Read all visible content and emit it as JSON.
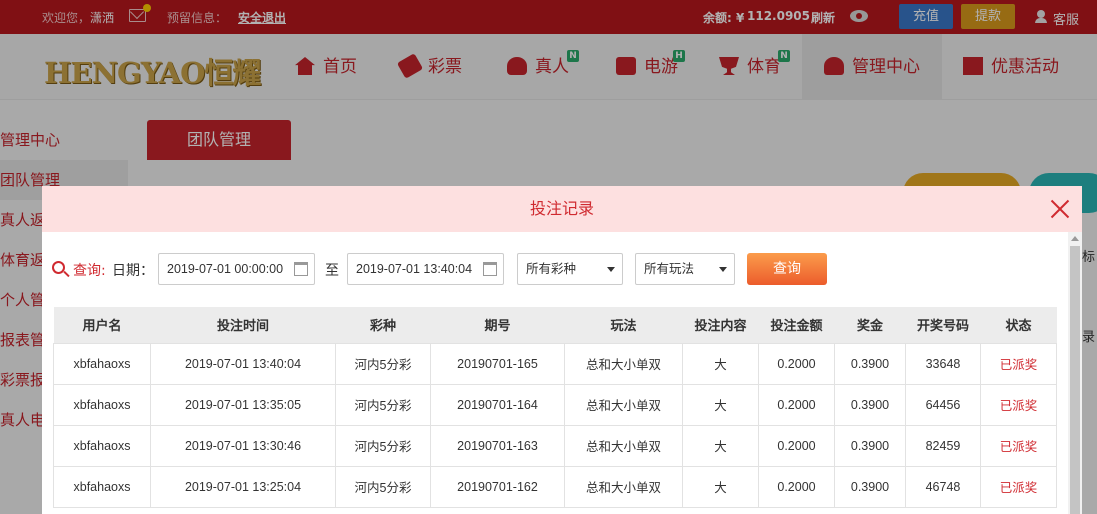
{
  "topbar": {
    "welcome": "欢迎您，",
    "username": "潇洒",
    "reserved_info_label": "预留信息：",
    "logout": "安全退出",
    "balance_label": "余额: ¥",
    "balance_value": "112.0905",
    "refresh": "刷新",
    "recharge": "充值",
    "withdraw": "提款",
    "customer_service": "客服"
  },
  "nav": {
    "logo": "HENGYAO恒耀",
    "items": [
      {
        "label": "首页"
      },
      {
        "label": "彩票"
      },
      {
        "label": "真人",
        "badge": "N"
      },
      {
        "label": "电游",
        "badge": "H"
      },
      {
        "label": "体育",
        "badge": "N"
      },
      {
        "label": "管理中心"
      },
      {
        "label": "优惠活动"
      }
    ]
  },
  "sidebar": {
    "items": [
      "管理中心",
      "团队管理",
      "真人返",
      "体育返",
      "个人管",
      "报表管",
      "彩票报",
      "真人电"
    ]
  },
  "content": {
    "tab": "团队管理",
    "edge_text_1": "标",
    "edge_text_2": "录"
  },
  "modal": {
    "title": "投注记录",
    "query_label": "查询:",
    "date_label": "日期：",
    "start_date": "2019-07-01 00:00:00",
    "to": "至",
    "end_date": "2019-07-01 13:40:04",
    "lottery_select": "所有彩种",
    "play_select": "所有玩法",
    "query_button": "查询"
  },
  "table": {
    "headers": [
      "用户名",
      "投注时间",
      "彩种",
      "期号",
      "玩法",
      "投注内容",
      "投注金额",
      "奖金",
      "开奖号码",
      "状态"
    ],
    "rows": [
      [
        "xbfahaoxs",
        "2019-07-01 13:40:04",
        "河内5分彩",
        "20190701-165",
        "总和大小单双",
        "大",
        "0.2000",
        "0.3900",
        "33648",
        "已派奖"
      ],
      [
        "xbfahaoxs",
        "2019-07-01 13:35:05",
        "河内5分彩",
        "20190701-164",
        "总和大小单双",
        "大",
        "0.2000",
        "0.3900",
        "64456",
        "已派奖"
      ],
      [
        "xbfahaoxs",
        "2019-07-01 13:30:46",
        "河内5分彩",
        "20190701-163",
        "总和大小单双",
        "大",
        "0.2000",
        "0.3900",
        "82459",
        "已派奖"
      ],
      [
        "xbfahaoxs",
        "2019-07-01 13:25:04",
        "河内5分彩",
        "20190701-162",
        "总和大小单双",
        "大",
        "0.2000",
        "0.3900",
        "46748",
        "已派奖"
      ]
    ]
  }
}
